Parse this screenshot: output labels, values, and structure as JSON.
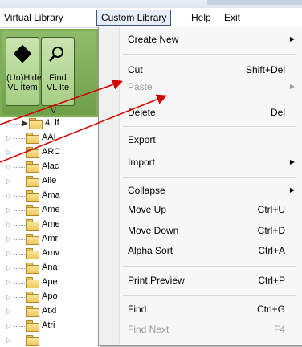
{
  "menubar": {
    "virtual_library": "Virtual Library",
    "custom_library": "Custom Library",
    "help": "Help",
    "exit": "Exit"
  },
  "ribbon": {
    "hide_button_line1": "(Un)Hide",
    "hide_button_line2": "VL Item",
    "find_button_line1": "Find",
    "find_button_line2": "VL Ite",
    "group_label": "V",
    "edge_chars": [
      "s",
      "e"
    ]
  },
  "tree": {
    "items": [
      "4Lif",
      "AAI",
      "ARC",
      "Alac",
      "Alle",
      "Ama",
      "Ame",
      "Ame",
      "Amr",
      "Amv",
      "Ana",
      "Ape",
      "Apo",
      "Atki",
      "Atri"
    ]
  },
  "dropdown": {
    "items": [
      {
        "label": "Create New",
        "shortcut": "",
        "submenu": true,
        "disabled": false
      },
      {
        "label": "Cut",
        "shortcut": "Shift+Del",
        "submenu": false,
        "disabled": false
      },
      {
        "label": "Paste",
        "shortcut": "",
        "submenu": true,
        "disabled": true
      },
      {
        "label": "Delete",
        "shortcut": "Del",
        "submenu": false,
        "disabled": false
      },
      {
        "label": "Export",
        "shortcut": "",
        "submenu": false,
        "disabled": false
      },
      {
        "label": "Import",
        "shortcut": "",
        "submenu": true,
        "disabled": false
      },
      {
        "label": "Collapse",
        "shortcut": "",
        "submenu": true,
        "disabled": false
      },
      {
        "label": "Move Up",
        "shortcut": "Ctrl+U",
        "submenu": false,
        "disabled": false
      },
      {
        "label": "Move Down",
        "shortcut": "Ctrl+D",
        "submenu": false,
        "disabled": false
      },
      {
        "label": "Alpha Sort",
        "shortcut": "Ctrl+A",
        "submenu": false,
        "disabled": false
      },
      {
        "label": "Print Preview",
        "shortcut": "Ctrl+P",
        "submenu": false,
        "disabled": false
      },
      {
        "label": "Find",
        "shortcut": "Ctrl+G",
        "submenu": false,
        "disabled": false
      },
      {
        "label": "Find Next",
        "shortcut": "F4",
        "submenu": false,
        "disabled": true
      }
    ]
  },
  "colors": {
    "ribbon_green": "#7fae59",
    "folder_yellow": "#f0c95a",
    "arrow_red": "#d40000",
    "menu_highlight_border": "#39557f"
  },
  "icons": [
    "diamond-icon",
    "magnifier-icon",
    "folder-icon",
    "expand-arrow-icon",
    "submenu-arrow-icon"
  ]
}
